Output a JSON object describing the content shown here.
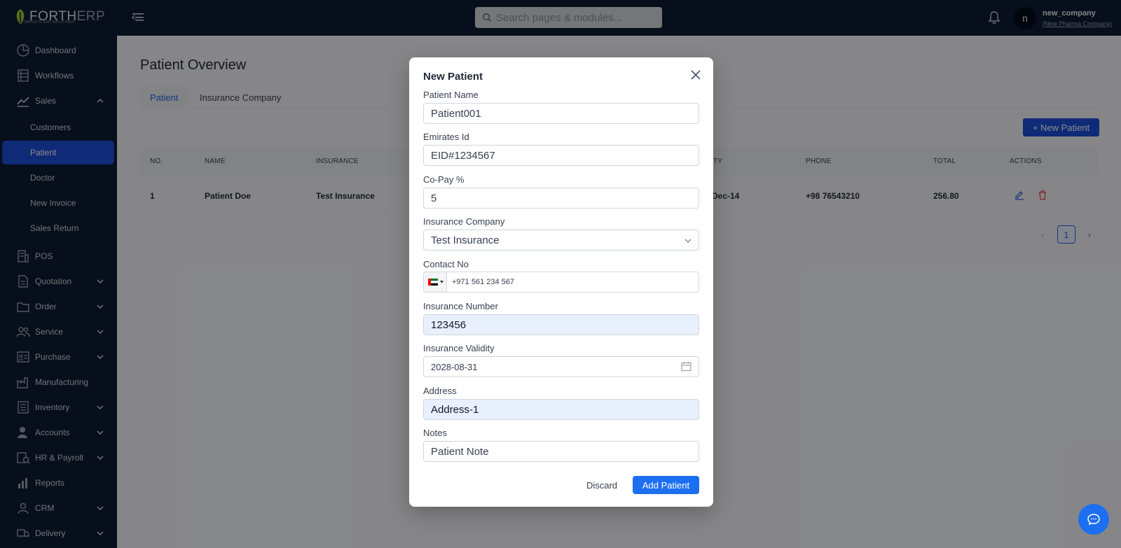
{
  "brand": {
    "name_main": "FORTH",
    "name_accent": "ERP",
    "tagline": "COMPLETE ERP SOLUTIONS"
  },
  "search": {
    "placeholder": "Search pages & modules..."
  },
  "user": {
    "initial": "n",
    "name": "new_company",
    "company": "(New Pharma Company)"
  },
  "sidebar": {
    "items": [
      {
        "label": "Dashboard",
        "icon": "pie-chart-icon"
      },
      {
        "label": "Workflows",
        "icon": "workflow-icon"
      },
      {
        "label": "Sales",
        "icon": "trend-line-icon",
        "expanded": true
      },
      {
        "label": "POS",
        "icon": "pos-icon"
      },
      {
        "label": "Quotation",
        "icon": "document-icon"
      },
      {
        "label": "Order",
        "icon": "folder-icon"
      },
      {
        "label": "Service",
        "icon": "people-icon"
      },
      {
        "label": "Purchase",
        "icon": "id-card-icon"
      },
      {
        "label": "Manufacturing",
        "icon": "factory-icon"
      },
      {
        "label": "Inventory",
        "icon": "inventory-icon"
      },
      {
        "label": "Accounts",
        "icon": "account-icon"
      },
      {
        "label": "HR & Payroll",
        "icon": "hr-icon"
      },
      {
        "label": "Reports",
        "icon": "bar-chart-icon"
      },
      {
        "label": "CRM",
        "icon": "crm-icon"
      },
      {
        "label": "Delivery",
        "icon": "truck-icon"
      }
    ],
    "sales_sub": [
      "Customers",
      "Patient",
      "Doctor",
      "New Invoice",
      "Sales Return"
    ],
    "active_sub": "Patient"
  },
  "page": {
    "title": "Patient Overview",
    "tabs": [
      "Patient",
      "Insurance Company"
    ],
    "new_button": "+ New Patient",
    "columns": [
      "NO.",
      "NAME",
      "INSURANCE",
      "TY",
      "PHONE",
      "TOTAL",
      "ACTIONS"
    ],
    "rows": [
      {
        "no": "1",
        "name": "Patient Doe",
        "insurance": "Test Insurance",
        "validity": "Dec-14",
        "phone": "+98 76543210",
        "total": "256.80"
      }
    ],
    "pagination": {
      "prev": "‹",
      "current": "1",
      "next": "›"
    }
  },
  "modal": {
    "title": "New Patient",
    "fields": {
      "patient_name": {
        "label": "Patient Name",
        "value": "Patient001"
      },
      "emirates_id": {
        "label": "Emirates Id",
        "value": "EID#1234567"
      },
      "copay": {
        "label": "Co-Pay %",
        "value": "5"
      },
      "insurance_company": {
        "label": "Insurance Company",
        "value": "Test Insurance"
      },
      "contact_no": {
        "label": "Contact No",
        "value": "+971 561 234 567",
        "flag": "UAE"
      },
      "insurance_number": {
        "label": "Insurance Number",
        "value": "123456"
      },
      "insurance_validity": {
        "label": "Insurance Validity",
        "value": "2028-08-31"
      },
      "address": {
        "label": "Address",
        "value": "Address-1"
      },
      "notes": {
        "label": "Notes",
        "value": "Patient Note"
      }
    },
    "discard_label": "Discard",
    "submit_label": "Add Patient"
  },
  "colors": {
    "primary": "#1d6ff2",
    "nav_bg": "#0e1b33",
    "danger": "#ef4444"
  }
}
